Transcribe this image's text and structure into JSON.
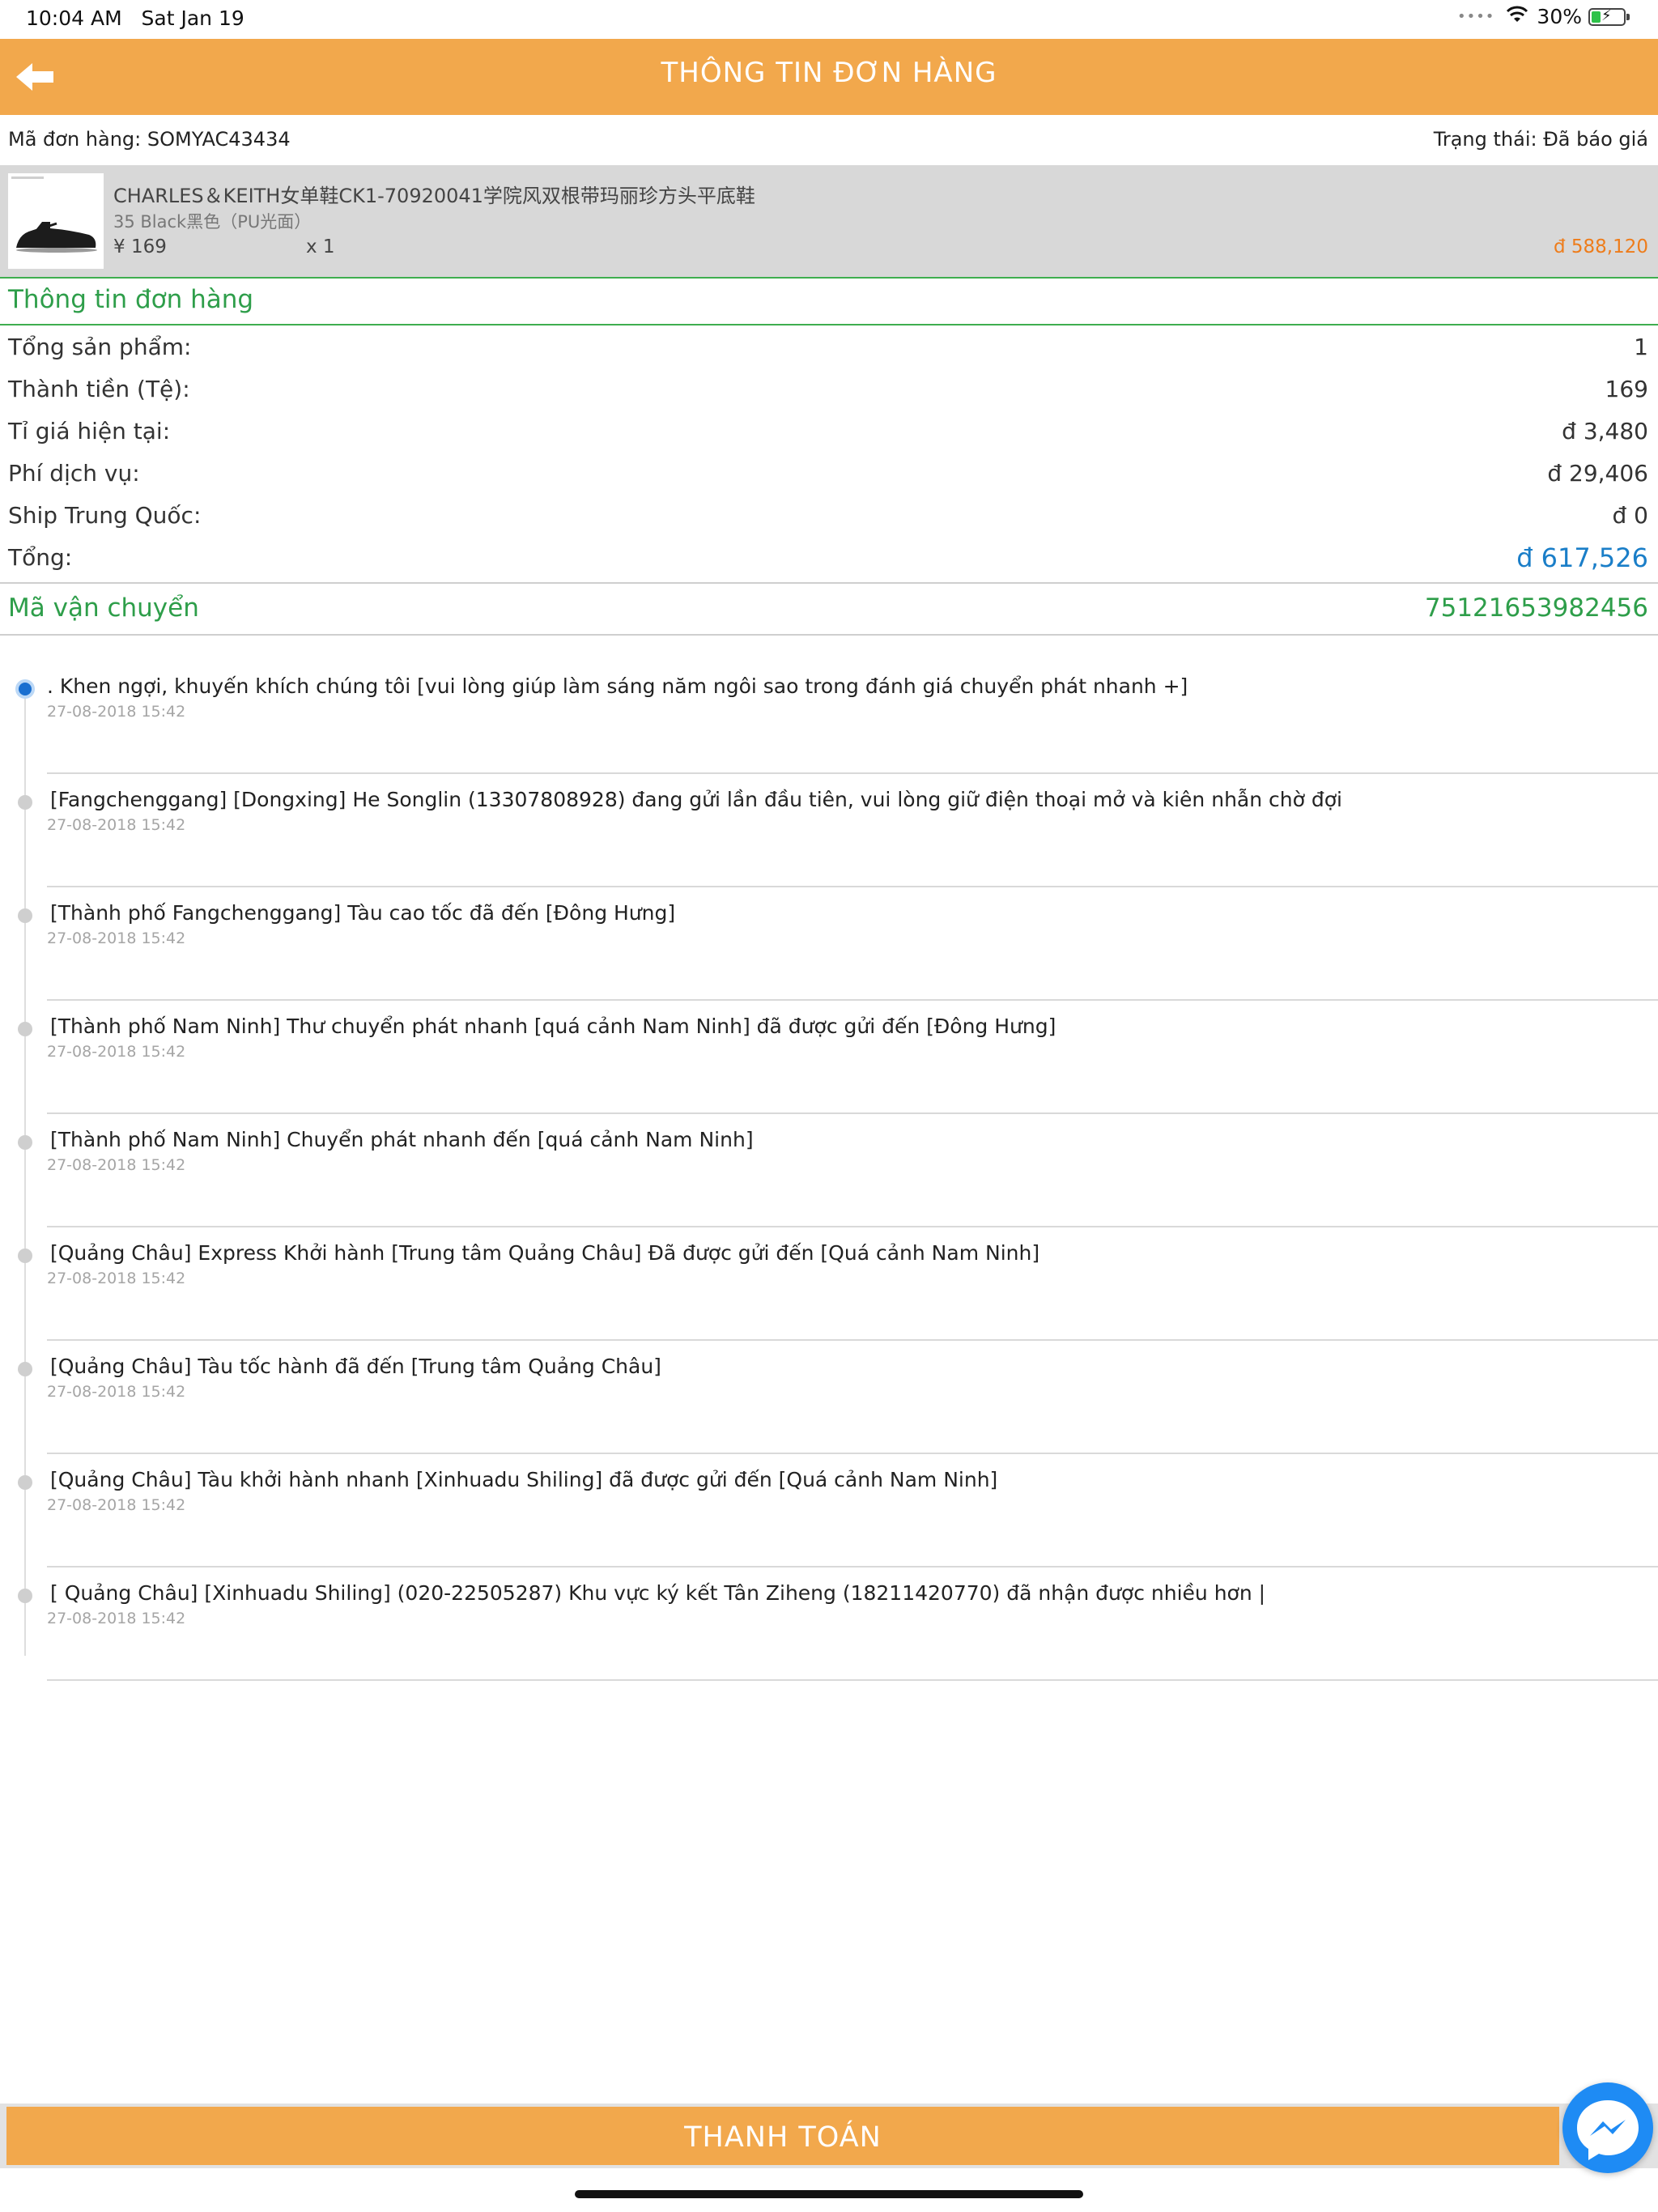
{
  "status_bar": {
    "time": "10:04 AM",
    "date": "Sat Jan 19",
    "battery": "30%",
    "battery_level": 0.3
  },
  "header": {
    "title": "THÔNG TIN ĐƠN HÀNG",
    "back_icon": "back-arrow-icon"
  },
  "order": {
    "code": "Mã đơn hàng: SOMYAC43434",
    "status": "Trạng thái: Đã báo giá"
  },
  "product": {
    "name": "CHARLES＆KEITH女单鞋CK1-70920041学院风双根带玛丽珍方头平底鞋",
    "variant": "35 Black黑色（PU光面）",
    "price": "¥ 169",
    "quantity": "x 1",
    "total": "đ 588,120"
  },
  "summary": {
    "title": "Thông tin đơn hàng",
    "rows": [
      {
        "label": "Tổng sản phẩm:",
        "value": "1"
      },
      {
        "label": "Thành tiền (Tệ):",
        "value": "169"
      },
      {
        "label": "Tỉ giá hiện tại:",
        "value": "đ 3,480"
      },
      {
        "label": "Phí dịch vụ:",
        "value": "đ 29,406"
      },
      {
        "label": "Ship Trung Quốc:",
        "value": "đ 0"
      },
      {
        "label": "Tổng:",
        "value": "đ 617,526"
      }
    ]
  },
  "tracking": {
    "title": "Mã vận chuyển",
    "code": "75121653982456",
    "events": [
      {
        "text": ". Khen ngợi, khuyến khích chúng tôi [vui lòng giúp làm sáng năm ngôi sao trong đánh giá chuyển phát nhanh +]",
        "time": "27-08-2018 15:42"
      },
      {
        "text": "[Fangchenggang] [Dongxing] He Songlin (13307808928) đang gửi lần đầu tiên, vui lòng giữ điện thoại mở và kiên nhẫn chờ đợi",
        "time": "27-08-2018 15:42"
      },
      {
        "text": "[Thành phố Fangchenggang] Tàu cao tốc đã đến [Đông Hưng]",
        "time": "27-08-2018 15:42"
      },
      {
        "text": "[Thành phố Nam Ninh] Thư chuyển phát nhanh [quá cảnh Nam Ninh] đã được gửi đến [Đông Hưng]",
        "time": "27-08-2018 15:42"
      },
      {
        "text": "[Thành phố Nam Ninh] Chuyển phát nhanh đến [quá cảnh Nam Ninh]",
        "time": "27-08-2018 15:42"
      },
      {
        "text": "[Quảng Châu] Express Khởi hành [Trung tâm Quảng Châu] Đã được gửi đến [Quá cảnh Nam Ninh]",
        "time": "27-08-2018 15:42"
      },
      {
        "text": "[Quảng Châu] Tàu tốc hành đã đến [Trung tâm Quảng Châu]",
        "time": "27-08-2018 15:42"
      },
      {
        "text": "[Quảng Châu] Tàu khởi hành nhanh [Xinhuadu Shiling] đã được gửi đến [Quá cảnh Nam Ninh]",
        "time": "27-08-2018 15:42"
      },
      {
        "text": "[ Quảng Châu] [Xinhuadu Shiling] (020-22505287) Khu vực ký kết Tân Ziheng (18211420770) đã nhận được nhiều hơn |",
        "time": "27-08-2018 15:42"
      }
    ]
  },
  "footer": {
    "pay_label": "THANH TOÁN",
    "messenger_icon": "messenger-icon"
  },
  "colors": {
    "header_bg": "#f2a84c",
    "accent_green": "#2e9e4a",
    "price_orange": "#ee7c1a",
    "total_blue": "#1a7ec8",
    "messenger_blue": "#1e8bf4"
  }
}
